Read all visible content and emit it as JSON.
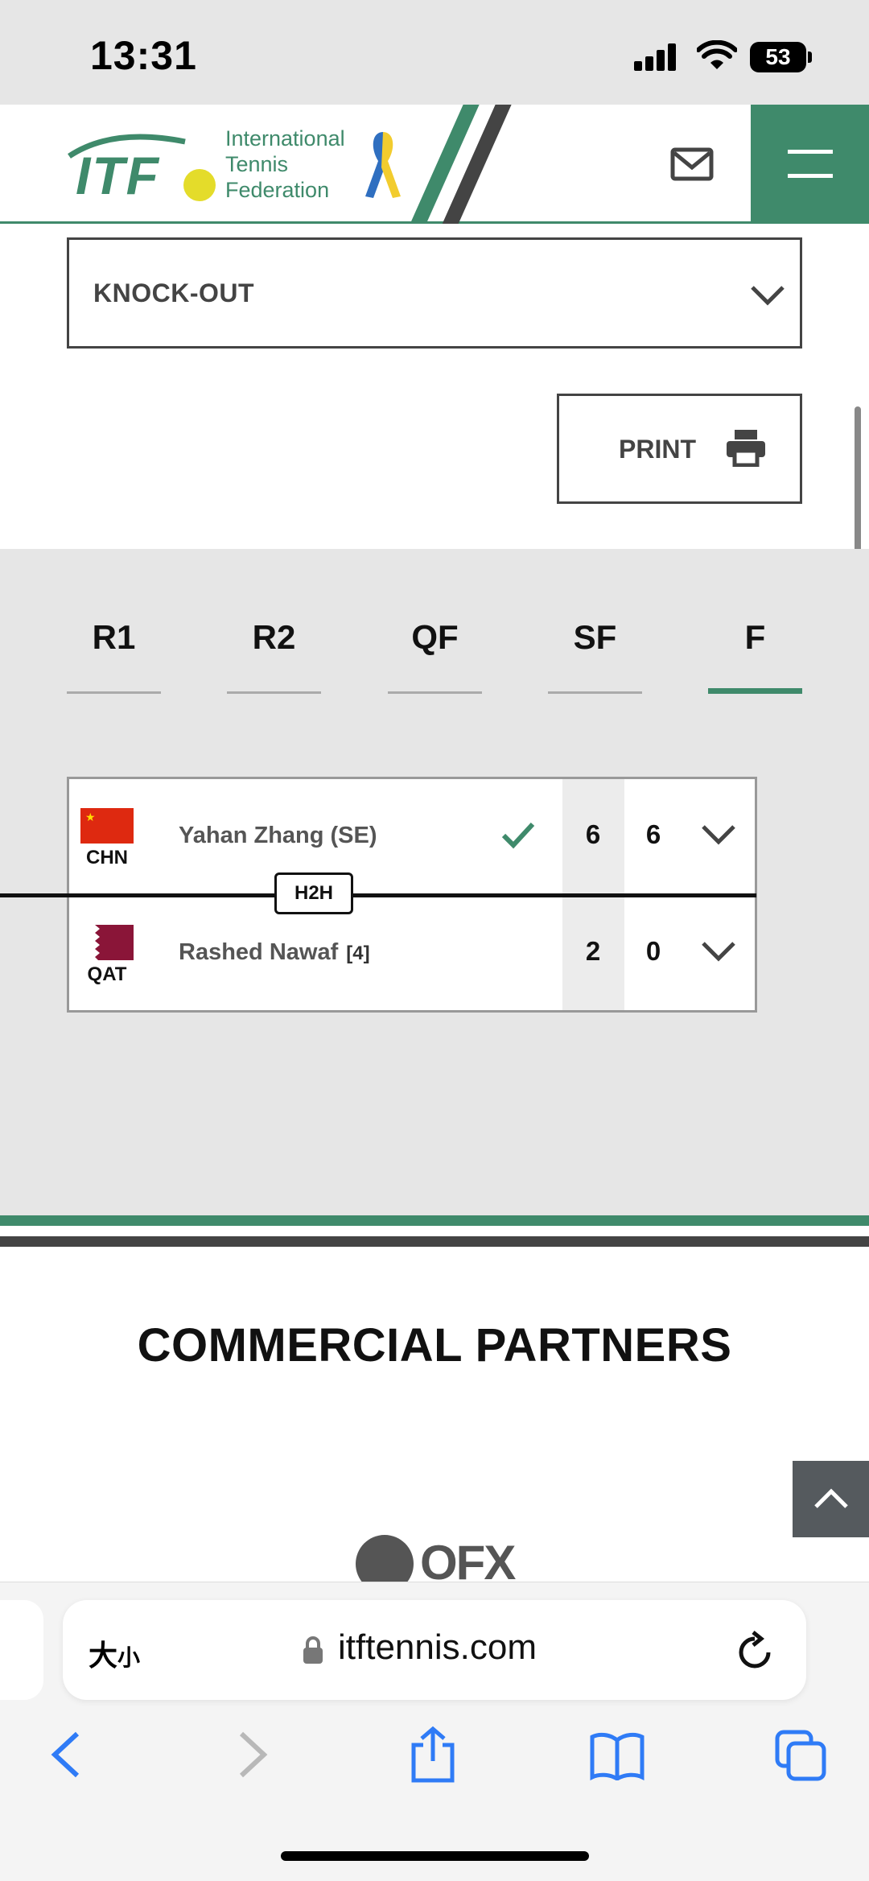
{
  "status_bar": {
    "time": "13:31",
    "battery": "53"
  },
  "header": {
    "logo_text": "ITF",
    "org_lines": [
      "International",
      "Tennis",
      "Federation"
    ],
    "brand_color": "#3f8a6b"
  },
  "draw_select": {
    "value": "KNOCK-OUT"
  },
  "print_button": {
    "label": "PRINT"
  },
  "rounds": {
    "tabs": [
      "R1",
      "R2",
      "QF",
      "SF",
      "F"
    ],
    "active": "F"
  },
  "match": {
    "h2h_label": "H2H",
    "players": [
      {
        "country": "CHN",
        "name": "Yahan Zhang (SE)",
        "seed": "",
        "winner": true,
        "sets": [
          "6",
          "6"
        ]
      },
      {
        "country": "QAT",
        "name": "Rashed Nawaf",
        "seed": "[4]",
        "winner": false,
        "sets": [
          "2",
          "0"
        ]
      }
    ]
  },
  "partners": {
    "title": "COMMERCIAL PARTNERS",
    "logo_text": "OFX"
  },
  "browser": {
    "text_size_label": "大",
    "text_size_small": "小",
    "url": "itftennis.com"
  }
}
